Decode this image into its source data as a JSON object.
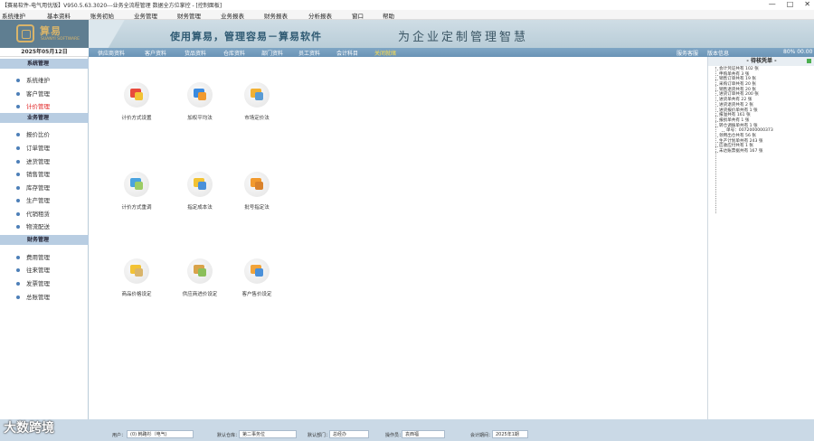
{
  "window": {
    "title": "【赛易软件-电气用优版】V950.5.63.3020---业务全流程管理 数据全方位掌控 - [控制面板]",
    "controls": [
      "—",
      "□",
      "✕"
    ]
  },
  "menu": [
    "系统维护",
    "基本资料",
    "账务初始",
    "业务管理",
    "财务管理",
    "业务报表",
    "财务报表",
    "分析报表",
    "窗口",
    "帮助"
  ],
  "banner": {
    "logo_text": "算易",
    "logo_sub": "SUANYI SOFTWARE",
    "slogan": "使用算易，管理容易－算易软件",
    "slogan2": "为企业定制管理智慧"
  },
  "date": "2025年05月12日",
  "nav": {
    "items": [
      "供应商资料",
      "客户资料",
      "货品资料",
      "仓库资料",
      "部门资料",
      "员工资料",
      "会计科目",
      "关闭就绪"
    ],
    "right": [
      "服务客服",
      "版本信息",
      "80% 00.00"
    ]
  },
  "sidebar": {
    "sections": [
      {
        "header": "系统管理",
        "items": [
          "系统维护",
          "客户管理",
          "计价管理"
        ]
      },
      {
        "header": "业务管理",
        "items": [
          "报价比价",
          "订单管理",
          "进货管理",
          "销售管理",
          "库存管理",
          "生产管理",
          "代销租赁",
          "物流配送"
        ]
      },
      {
        "header": "财务管理",
        "items": [
          "费用管理",
          "往来管理",
          "发票管理",
          "总账管理"
        ]
      }
    ],
    "active_item": "计价管理"
  },
  "tiles": [
    {
      "label": "计价方式设置",
      "icon": "pricing-settings-icon",
      "color_a": "#e84a3c",
      "color_b": "#f2c234"
    },
    {
      "label": "加权平均法",
      "icon": "weighted-average-icon",
      "color_a": "#3b8be0",
      "color_b": "#f29a2e"
    },
    {
      "label": "市场定价法",
      "icon": "market-price-icon",
      "color_a": "#f2b134",
      "color_b": "#5a9bd4"
    },
    {
      "label": "计价方式重调",
      "icon": "pricing-adjust-icon",
      "color_a": "#4aa3df",
      "color_b": "#9ccc65"
    },
    {
      "label": "指定成本法",
      "icon": "specified-cost-icon",
      "color_a": "#f2c234",
      "color_b": "#4a90d9"
    },
    {
      "label": "批号指定法",
      "icon": "batch-number-icon",
      "color_a": "#f29a2e",
      "color_b": "#d9822b"
    },
    {
      "label": "商品价格设定",
      "icon": "product-price-icon",
      "color_a": "#f2c234",
      "color_b": "#d9b46a"
    },
    {
      "label": "供应商进价设定",
      "icon": "supplier-price-icon",
      "color_a": "#d9a34a",
      "color_b": "#8bbf5a"
    },
    {
      "label": "客户售价设定",
      "icon": "customer-price-icon",
      "color_a": "#f2a43a",
      "color_b": "#4a90d9"
    }
  ],
  "todo": {
    "title": "- 待核凭单 -",
    "rows": [
      {
        "text": "会计凭证共有 102 张",
        "child": false
      },
      {
        "text": "申购单共有 3 张",
        "child": false
      },
      {
        "text": "销售订单共有 19 张",
        "child": false
      },
      {
        "text": "采购订单共有 20 张",
        "child": false
      },
      {
        "text": "销售退货共有 20 张",
        "child": false
      },
      {
        "text": "进货订单共有 200 张",
        "child": false
      },
      {
        "text": "进货单共有 22 张",
        "child": false
      },
      {
        "text": "进货退货共有 2 张",
        "child": false
      },
      {
        "text": "进货报价单共有 1 张",
        "child": false
      },
      {
        "text": "报溢共有 161 张",
        "child": false
      },
      {
        "text": "报损单共有 1 张",
        "child": false
      },
      {
        "text": "转仓调拨单共有 1 张",
        "child": false
      },
      {
        "text": "单号：0072000000373",
        "child": true
      },
      {
        "text": "领用出仓共有 56 张",
        "child": false
      },
      {
        "text": "生产计划单共有 243 张",
        "child": false
      },
      {
        "text": "应收应付共有 1 张",
        "child": false
      },
      {
        "text": "未达账票据共有 167 张",
        "child": false
      }
    ]
  },
  "status": {
    "items": [
      {
        "label": "用户：",
        "value": "(0) 韩路杉（电气)"
      },
      {
        "label": "默认仓库：",
        "value": "第二事务位"
      },
      {
        "label": "默认部门：",
        "value": "总经办"
      },
      {
        "label": "操作员：",
        "value": "袁西福"
      },
      {
        "label": "会计期间：",
        "value": "2025年1期"
      }
    ],
    "watermark": "大数跨境"
  }
}
